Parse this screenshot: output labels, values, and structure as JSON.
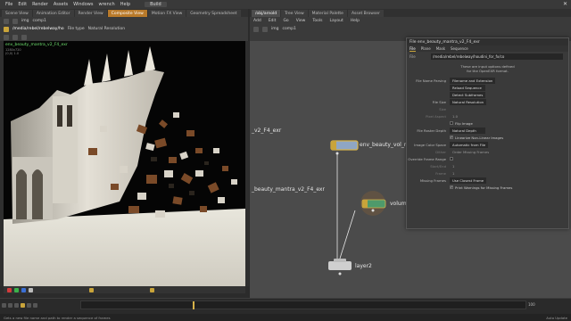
{
  "menubar": {
    "items": [
      "File",
      "Edit",
      "Render",
      "Assets",
      "Windows",
      "wrench",
      "Help"
    ],
    "build": "Build"
  },
  "left_tabs": [
    "Scene View",
    "Animation Editor",
    "Render View",
    "Composite View",
    "Motion FX View",
    "Geometry Spreadsheet"
  ],
  "right_tabs": [
    "/obj/arnold",
    "Tree View",
    "Material Palette",
    "Asset Browser"
  ],
  "left_toolbar": {
    "path": "img",
    "context": "comp1"
  },
  "viewport_toolbar": {
    "path": "/media/rebel/rebelway/ho",
    "file_type": "File type",
    "resolution": "Natural Resolution"
  },
  "viewport": {
    "label": "env_beauty_mantra_v2_F4_exr",
    "sub1": "1280x720",
    "sub2": "(0,0) 1.0"
  },
  "network_menu": [
    "Add",
    "Edit",
    "Go",
    "View",
    "Tools",
    "Layout",
    "Help"
  ],
  "network_toolbar": {
    "path": "img",
    "context": "comp1"
  },
  "nodes": {
    "n1_side_label": "_v2_F4_exr",
    "n1_label": "env_beauty_vol_m",
    "n2_side_label": "_beauty_mantra_v2_F4_exr",
    "n2_label": "volum",
    "n3_label": "layer2"
  },
  "param_panel": {
    "title": "File  env_beauty_mantra_v2_F4_exr",
    "tabs": [
      "File",
      "Plane",
      "Mask",
      "Sequence"
    ],
    "file_label": "File",
    "file_value": "/media/rebel/rebelway/houdini_for_fx/co",
    "note1": "These are input options defined",
    "note2": "for the OpenEXR format.",
    "file_name_parsing_label": "File Name Parsing",
    "file_name_parsing_value": "Filename and Extension",
    "reload_sequence": "Reload Sequence",
    "detect_subframes": "Detect Subframes",
    "file_size_label": "File Size",
    "file_size_value": "Natural Resolution",
    "size_label": "Size",
    "pixel_aspect_label": "Pixel Aspect",
    "pixel_aspect_value": "1.0",
    "flip_image": "Flip Image",
    "file_raster_depth_label": "File Raster Depth",
    "file_raster_depth_value": "Natural Depth",
    "linearize": "Linearize Non-Linear Images",
    "image_color_space_label": "Image Color Space",
    "image_color_space_value": "Automatic from File",
    "dither_label": "Dither",
    "dither_value": "Order Missing Frames",
    "override_frame_range_label": "Override Frame Range",
    "start_end_label": "Start/End",
    "start_end_value": "1",
    "frame_label": "Frame",
    "frame_value": "1",
    "missing_frames_label": "Missing Frames",
    "missing_frames_value": "Use Closest Frame",
    "print_warnings": "Print Warnings for Missing Frames"
  },
  "timeline": {
    "frame": "100"
  },
  "statusbar": {
    "left": "Gets a new file name and path to render a sequence of frames",
    "right": "Auto Update"
  },
  "colors": {
    "accent": "#c9a43a",
    "viewport_label": "#6fe36f",
    "network_bg": "#4b4b4b"
  }
}
